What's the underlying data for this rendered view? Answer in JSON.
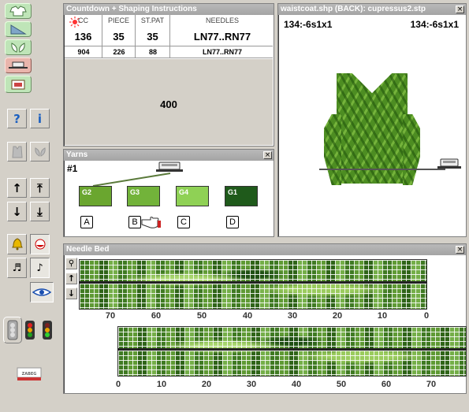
{
  "colors": {
    "yarn_g2": "#6aa62f",
    "yarn_g3": "#72b33a",
    "yarn_g4": "#8fd155",
    "yarn_g1": "#1f5a1b"
  },
  "toolbar": {
    "help_label": "?",
    "info_label": "i",
    "up_label": "↑",
    "top_label": "⤒",
    "down_label": "↓",
    "bottom_label": "⤓",
    "bell_icon": "bell-icon",
    "music_icon": "music-icon",
    "note_icon": "note-icon",
    "eye_icon": "eye-icon"
  },
  "countdown": {
    "title": "Countdown + Shaping Instructions",
    "headers": [
      "CC",
      "PIECE",
      "ST.PAT",
      "NEEDLES"
    ],
    "row1": [
      "136",
      "35",
      "35",
      "LN77..RN77"
    ],
    "row2": [
      "904",
      "226",
      "88",
      "LN77..RN77"
    ],
    "center_value": "400"
  },
  "garment": {
    "title": "waistcoat.shp (BACK): cupressus2.stp",
    "left_label": "134:-6s1x1",
    "right_label": "134:-6s1x1"
  },
  "yarns": {
    "title": "Yarns",
    "current": "#1",
    "swatches": [
      {
        "label": "G2",
        "feeder": "A"
      },
      {
        "label": "G3",
        "feeder": "B"
      },
      {
        "label": "G4",
        "feeder": "C"
      },
      {
        "label": "G1",
        "feeder": "D"
      }
    ]
  },
  "needle_bed": {
    "title": "Needle Bed",
    "top_scale": [
      "70",
      "60",
      "50",
      "40",
      "30",
      "20",
      "10",
      "0"
    ],
    "bottom_scale": [
      "0",
      "10",
      "20",
      "30",
      "40",
      "50",
      "60",
      "70"
    ]
  }
}
